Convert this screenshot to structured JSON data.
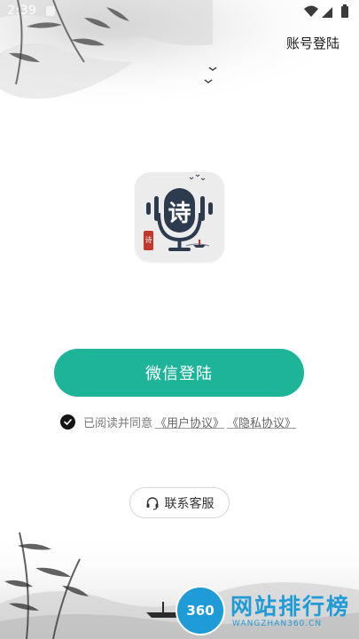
{
  "status_bar": {
    "time": "2:39",
    "icons": [
      "wifi-icon",
      "signal-icon",
      "battery-icon"
    ]
  },
  "header": {
    "account_login": "账号登陆"
  },
  "app": {
    "logo_char": "诗",
    "seal_text": "诗"
  },
  "login": {
    "wechat_button": "微信登陆"
  },
  "agreement": {
    "checked": true,
    "text": "已阅读并同意",
    "user_agreement": "《用户协议》",
    "privacy_policy": "《隐私协议》"
  },
  "support": {
    "label": "联系客服"
  },
  "watermark": {
    "logo": "360",
    "title": "网站排行榜",
    "subtitle": "WANGZHAN360.CN"
  },
  "colors": {
    "primary": "#1eb49a",
    "icon_mic": "#2d3b4e",
    "watermark": "#1f9bd7"
  }
}
